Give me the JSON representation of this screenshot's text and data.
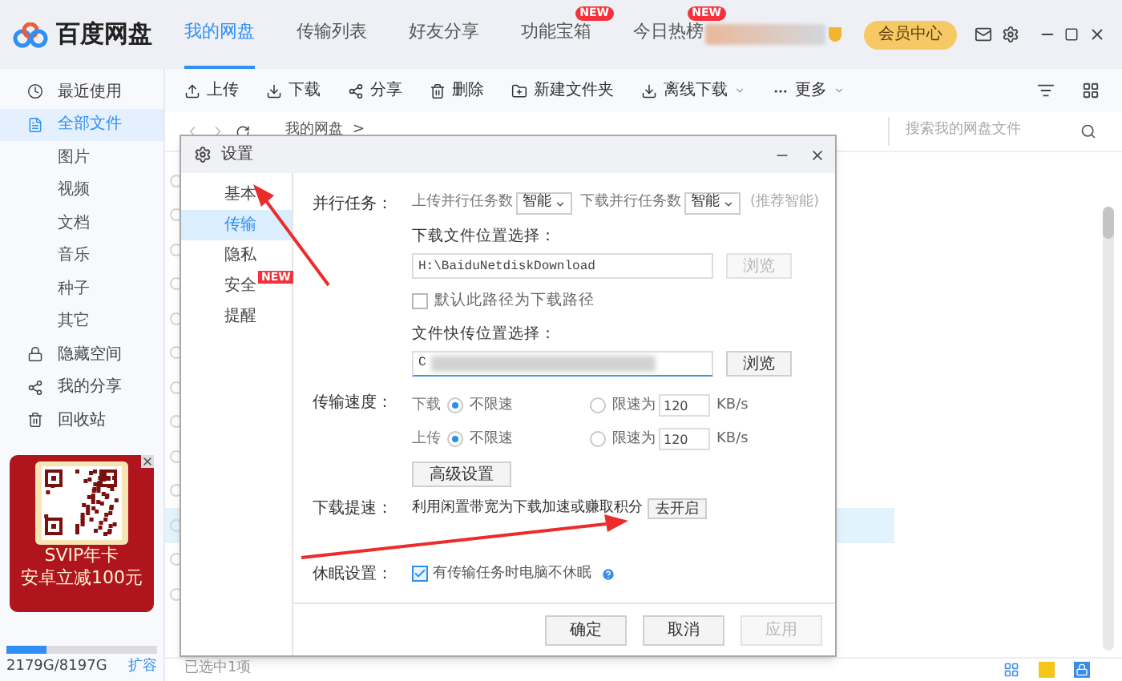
{
  "app": {
    "logo_text": "百度网盘",
    "nav_tabs": [
      {
        "label": "我的网盘",
        "selected": true
      },
      {
        "label": "传输列表",
        "selected": false
      },
      {
        "label": "好友分享",
        "selected": false
      },
      {
        "label": "功能宝箱",
        "selected": false,
        "badge": "NEW"
      },
      {
        "label": "今日热榜",
        "selected": false,
        "badge": "NEW"
      }
    ],
    "member_button": "会员中心"
  },
  "sidebar": {
    "items": [
      {
        "label": "最近使用",
        "kind": "clock",
        "selected": false
      },
      {
        "label": "全部文件",
        "kind": "file",
        "selected": true,
        "children": [
          {
            "label": "图片"
          },
          {
            "label": "视频"
          },
          {
            "label": "文档"
          },
          {
            "label": "音乐"
          },
          {
            "label": "种子"
          },
          {
            "label": "其它"
          }
        ]
      },
      {
        "label": "隐藏空间",
        "kind": "lock",
        "selected": false
      },
      {
        "label": "我的分享",
        "kind": "share",
        "selected": false
      },
      {
        "label": "回收站",
        "kind": "trash",
        "selected": false
      }
    ],
    "ad": {
      "lines": [
        "SVIP年卡",
        "安卓立减100元"
      ]
    },
    "storage": {
      "level": 0.27,
      "text": "2179G/8197G",
      "link": "扩容"
    }
  },
  "toolbar": {
    "items": [
      {
        "label": "上传",
        "kind": "upload",
        "dropdown": false
      },
      {
        "label": "下载",
        "kind": "download",
        "dropdown": false
      },
      {
        "label": "分享",
        "kind": "share",
        "dropdown": false
      },
      {
        "label": "删除",
        "kind": "trash",
        "dropdown": false
      },
      {
        "label": "新建文件夹",
        "kind": "folder",
        "dropdown": false
      },
      {
        "label": "离线下载",
        "kind": "download",
        "dropdown": true
      },
      {
        "label": "更多",
        "kind": "more",
        "dropdown": true
      }
    ]
  },
  "breadcrumb": {
    "path": "我的网盘",
    "separator": ">"
  },
  "search": {
    "placeholder": "搜索我的网盘文件"
  },
  "file_rows": [
    {
      "selected": false
    },
    {
      "selected": false
    },
    {
      "selected": false
    },
    {
      "selected": false
    },
    {
      "selected": false
    },
    {
      "selected": false
    },
    {
      "selected": false
    },
    {
      "selected": false
    },
    {
      "selected": false
    },
    {
      "selected": false
    },
    {
      "selected": true
    },
    {
      "selected": false
    },
    {
      "selected": false
    }
  ],
  "status_bar": "已选中1项",
  "dialog": {
    "title": "设置",
    "menu": [
      {
        "label": "基本",
        "selected": false
      },
      {
        "label": "传输",
        "selected": true
      },
      {
        "label": "隐私",
        "selected": false
      },
      {
        "label": "安全",
        "selected": false,
        "badge": "NEW"
      },
      {
        "label": "提醒",
        "selected": false
      }
    ],
    "parallel": {
      "label": "并行任务：",
      "upload_label": "上传并行任务数",
      "upload_value": "智能",
      "download_label": "下载并行任务数",
      "download_value": "智能",
      "hint": "(推荐智能)"
    },
    "download_location": {
      "label": "下载文件位置选择：",
      "value": "H:\\BaiduNetdiskDownload",
      "browse": "浏览",
      "browse_disabled": true
    },
    "default_path": {
      "label": "默认此路径为下载路径",
      "checked": false
    },
    "quick_location": {
      "label": "文件快传位置选择：",
      "value": "C",
      "browse": "浏览",
      "browse_disabled": false
    },
    "speed": {
      "label": "传输速度：",
      "rows": [
        {
          "label": "下载",
          "unlimited": "不限速",
          "limit": "限速为",
          "value": "120",
          "unit": "KB/s",
          "unlimited_selected": true
        },
        {
          "label": "上传",
          "unlimited": "不限速",
          "limit": "限速为",
          "value": "120",
          "unit": "KB/s",
          "unlimited_selected": true
        }
      ],
      "advanced": "高级设置"
    },
    "boost": {
      "label": "下载提速：",
      "text": "利用闲置带宽为下载加速或赚取积分",
      "button": "去开启"
    },
    "sleep": {
      "label": "休眠设置：",
      "text": "有传输任务时电脑不休眠",
      "checked": true
    },
    "buttons": [
      {
        "label": "确定",
        "disabled": false
      },
      {
        "label": "取消",
        "disabled": false
      },
      {
        "label": "应用",
        "disabled": true
      }
    ]
  }
}
